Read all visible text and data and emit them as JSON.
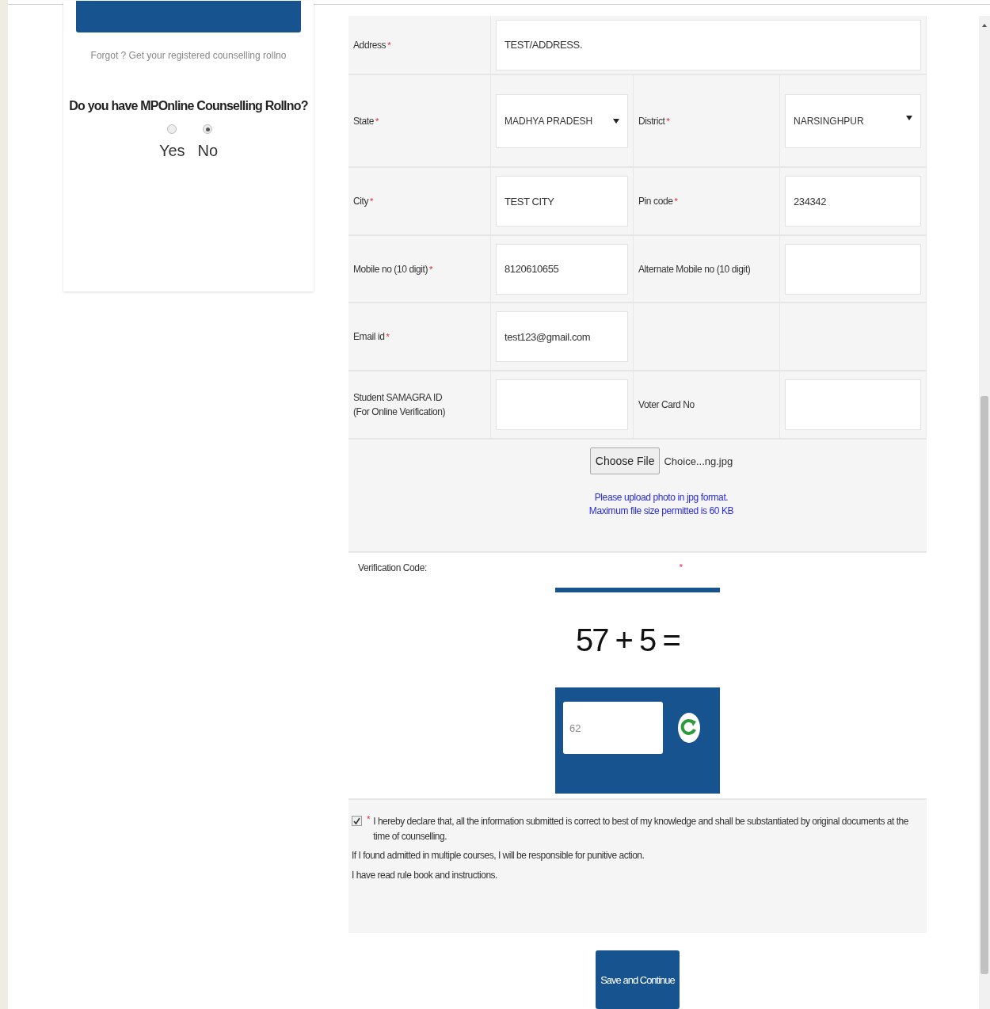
{
  "left_panel": {
    "forgot_link": "Forgot ? Get your registered counselling rollno",
    "question": "Do you have MPOnline Counselling Rollno?",
    "options": [
      {
        "label": "Yes",
        "selected": false
      },
      {
        "label": "No",
        "selected": true
      }
    ]
  },
  "form": {
    "rows": [
      {
        "fields": [
          {
            "label": "Address",
            "mark": "*",
            "kind": "text",
            "value": "TEST/ADDRESS."
          }
        ]
      },
      {
        "fields": [
          {
            "label": "State",
            "mark": "*",
            "kind": "select",
            "value": "MADHYA PRADESH"
          },
          {
            "label": "District",
            "mark": "*",
            "kind": "select",
            "value": "NARSINGHPUR"
          }
        ]
      },
      {
        "fields": [
          {
            "label": "City",
            "mark": "*",
            "kind": "text",
            "value": "TEST CITY"
          },
          {
            "label": "Pin code",
            "mark": "*",
            "kind": "text",
            "value": "234342"
          }
        ]
      },
      {
        "fields": [
          {
            "label": "Mobile no (10 digit)",
            "mark": "*",
            "kind": "text",
            "value": "8120610655"
          },
          {
            "label": "Alternate Mobile no (10 digit)",
            "kind": "text"
          }
        ]
      },
      {
        "fields": [
          {
            "label": "Email id",
            "mark": "*",
            "kind": "text",
            "value": "test123@gmail.com"
          },
          {
            "kind": "blank"
          }
        ]
      },
      {
        "fields": [
          {
            "label": "Student SAMAGRA ID",
            "sublabel": "(For Online Verification)",
            "kind": "text"
          },
          {
            "label": "Voter Card No",
            "kind": "text"
          }
        ]
      }
    ],
    "upload": {
      "button": "Choose File",
      "filename": "Choice...ng.jpg",
      "hints": [
        "Please upload photo in jpg format.",
        "Maximum file size permitted is 60 KB"
      ]
    },
    "verification": {
      "label": "Verification Code:",
      "mark": "*",
      "question": "57 + 5 =",
      "answer": "62"
    },
    "declaration": {
      "checked": true,
      "mark": "*",
      "lines": [
        "I hereby declare that, all the information submitted is correct to best of my knowledge and shall be substantiated by original documents at the time of counselling.",
        "If I found admitted in multiple courses, I will be responsible for punitive action.",
        "I have read rule book and instructions."
      ]
    },
    "submit": "Save and Continue"
  }
}
